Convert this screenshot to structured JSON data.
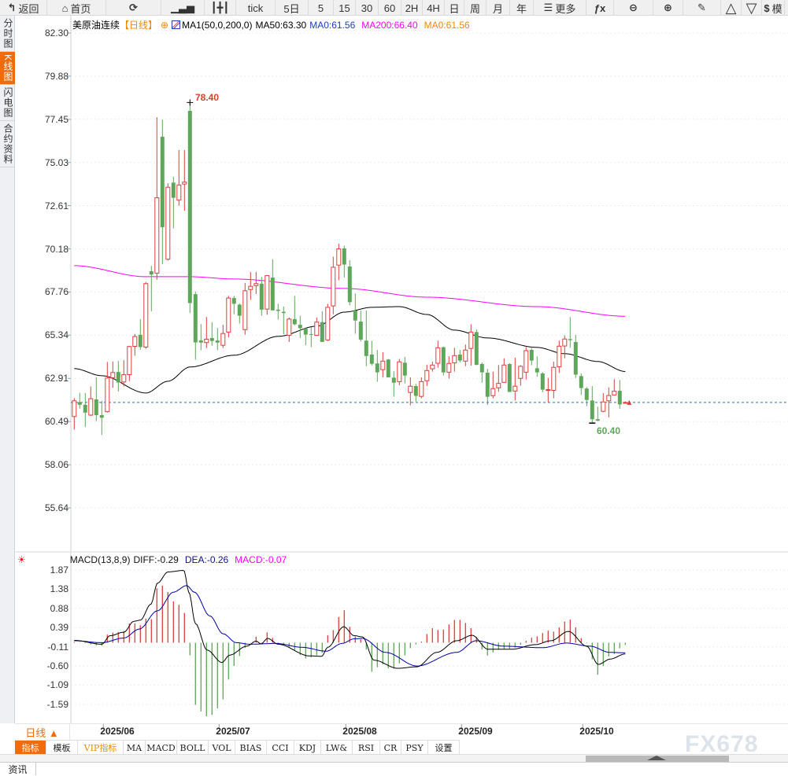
{
  "toolbar": {
    "items": [
      {
        "label": "返回",
        "icon": "back-arrow-icon"
      },
      {
        "label": "首页",
        "icon": "home-icon"
      },
      {
        "label": "",
        "icon": "refresh-icon"
      },
      {
        "label": "",
        "icon": "bar-chart-icon"
      },
      {
        "label": "",
        "icon": "candlestick-icon"
      },
      {
        "label": "tick"
      },
      {
        "label": "5日"
      },
      {
        "label": "5"
      },
      {
        "label": "15"
      },
      {
        "label": "30"
      },
      {
        "label": "60"
      },
      {
        "label": "2H"
      },
      {
        "label": "4H"
      },
      {
        "label": "日"
      },
      {
        "label": "周"
      },
      {
        "label": "月"
      },
      {
        "label": "年"
      },
      {
        "label": "更多",
        "icon": "menu-icon"
      },
      {
        "label": "fx",
        "icon": "function-icon"
      },
      {
        "label": "",
        "icon": "zoom-out-icon"
      },
      {
        "label": "",
        "icon": "zoom-in-icon"
      },
      {
        "label": "",
        "icon": "pen-icon"
      },
      {
        "label": "",
        "icon": "triangle-up-icon"
      },
      {
        "label": "",
        "icon": "triangle-down-icon"
      },
      {
        "label": "模",
        "icon": "dollar-icon"
      }
    ]
  },
  "sidebar": {
    "items": [
      {
        "label": "分时图"
      },
      {
        "label": "K线图",
        "active": true
      },
      {
        "label": "闪电图"
      },
      {
        "label": "合约资料"
      }
    ]
  },
  "legend": {
    "symbol": "美原油连续",
    "period": "【日线】",
    "indicator": "MA1(50,0,200,0)",
    "ma50": "MA50:63.30",
    "ma0a": "MA0:61.56",
    "ma200": "MA200:66.40",
    "ma0b": "MA0:61.56"
  },
  "macd_legend": {
    "name": "MACD(13,8,9)",
    "diff": "DIFF:-0.29",
    "dea": "DEA:-0.26",
    "macd": "MACD:-0.07"
  },
  "colors": {
    "up": "#e03c3c",
    "down": "#5ea65a",
    "ma50": "#000000",
    "ma200": "#ff00ff",
    "current_line": "#1e6fd9",
    "diff": "#000000",
    "dea": "#0000aa",
    "accent": "#f26b0a"
  },
  "chart_data": [
    {
      "type": "candlestick",
      "ylim": [
        55.64,
        82.3
      ],
      "y_ticks": [
        "82.30",
        "79.88",
        "77.45",
        "75.03",
        "72.61",
        "70.18",
        "67.76",
        "65.34",
        "62.91",
        "60.49",
        "58.06",
        "55.64"
      ],
      "x_ticks": [
        {
          "label": "2025/06",
          "bar": 7
        },
        {
          "label": "2025/07",
          "bar": 28
        },
        {
          "label": "2025/08",
          "bar": 51
        },
        {
          "label": "2025/09",
          "bar": 72
        },
        {
          "label": "2025/10",
          "bar": 94
        }
      ],
      "high_label": "78.40",
      "low_label": "60.40",
      "current_price": 61.56,
      "ohlc": [
        [
          60.77,
          61.8,
          60.04,
          61.65
        ],
        [
          61.58,
          62.1,
          61.21,
          61.43
        ],
        [
          61.43,
          62.1,
          60.18,
          60.99
        ],
        [
          60.85,
          62.46,
          60.8,
          61.77
        ],
        [
          61.73,
          62.98,
          60.51,
          60.85
        ],
        [
          60.85,
          61.65,
          59.74,
          60.7
        ],
        [
          61.04,
          63.83,
          60.99,
          62.93
        ],
        [
          62.95,
          63.86,
          62.39,
          63.24
        ],
        [
          63.27,
          63.89,
          62.17,
          62.68
        ],
        [
          62.71,
          63.93,
          62.46,
          63.12
        ],
        [
          63.12,
          64.74,
          62.76,
          64.7
        ],
        [
          64.71,
          65.4,
          64.18,
          65.26
        ],
        [
          65.36,
          66.24,
          64.52,
          64.67
        ],
        [
          64.67,
          68.32,
          64.57,
          68.23
        ],
        [
          68.93,
          69.23,
          66.68,
          68.74
        ],
        [
          68.82,
          77.57,
          68.45,
          73.05
        ],
        [
          76.48,
          77.43,
          69.33,
          71.4
        ],
        [
          69.6,
          73.86,
          69.52,
          73.64
        ],
        [
          73.9,
          74.23,
          71.33,
          73.05
        ],
        [
          72.93,
          75.73,
          72.61,
          73.77
        ],
        [
          73.82,
          75.73,
          72.32,
          73.93
        ],
        [
          77.93,
          78.4,
          66.58,
          67.14
        ],
        [
          67.64,
          67.79,
          63.96,
          64.93
        ],
        [
          65.04,
          65.96,
          64.49,
          64.92
        ],
        [
          64.92,
          66.36,
          64.62,
          65.11
        ],
        [
          65.18,
          66.07,
          64.74,
          65.01
        ],
        [
          65.04,
          65.74,
          64.49,
          64.92
        ],
        [
          64.77,
          65.92,
          64.62,
          65.43
        ],
        [
          65.51,
          67.54,
          65.21,
          67.42
        ],
        [
          67.42,
          67.54,
          66.51,
          67.1
        ],
        [
          67.05,
          67.12,
          65.99,
          66.43
        ],
        [
          65.65,
          68.27,
          65.37,
          67.83
        ],
        [
          67.9,
          68.89,
          67.32,
          68.08
        ],
        [
          68.12,
          68.89,
          67.65,
          68.23
        ],
        [
          68.23,
          68.61,
          66.43,
          66.77
        ],
        [
          66.8,
          68.71,
          66.48,
          68.68
        ],
        [
          68.57,
          69.6,
          66.73,
          66.73
        ],
        [
          66.77,
          67.1,
          66.21,
          66.7
        ],
        [
          66.65,
          66.95,
          65.4,
          66.58
        ],
        [
          65.33,
          66.33,
          64.96,
          66.24
        ],
        [
          66.24,
          67.54,
          65.89,
          65.95
        ],
        [
          65.92,
          66.43,
          65.18,
          65.73
        ],
        [
          65.7,
          65.77,
          64.77,
          65.37
        ],
        [
          65.4,
          65.77,
          64.67,
          65.36
        ],
        [
          65.33,
          66.33,
          65.3,
          66.07
        ],
        [
          66.07,
          66.68,
          64.96,
          64.96
        ],
        [
          65.07,
          67.1,
          65.01,
          66.9
        ],
        [
          66.98,
          69.74,
          66.51,
          69.15
        ],
        [
          69.27,
          70.48,
          68.42,
          70.18
        ],
        [
          70.21,
          70.37,
          68.57,
          69.3
        ],
        [
          69.19,
          69.54,
          67.01,
          67.19
        ],
        [
          66.72,
          67.68,
          65.42,
          66.16
        ],
        [
          66.1,
          66.72,
          64.98,
          65.09
        ],
        [
          65.03,
          66.72,
          63.6,
          64.17
        ],
        [
          64.25,
          65.03,
          63.63,
          63.73
        ],
        [
          63.75,
          64.51,
          62.72,
          63.25
        ],
        [
          63.4,
          64.38,
          62.97,
          63.88
        ],
        [
          63.97,
          64.0,
          62.97,
          62.97
        ],
        [
          62.95,
          63.31,
          61.88,
          62.67
        ],
        [
          62.73,
          64.0,
          62.53,
          63.84
        ],
        [
          63.79,
          64.12,
          62.63,
          63.07
        ],
        [
          62.12,
          62.97,
          61.4,
          62.47
        ],
        [
          62.48,
          62.6,
          61.6,
          61.93
        ],
        [
          61.9,
          62.97,
          61.79,
          62.73
        ],
        [
          62.78,
          63.68,
          62.48,
          63.35
        ],
        [
          63.45,
          63.85,
          63.29,
          63.66
        ],
        [
          63.76,
          65.03,
          63.51,
          64.63
        ],
        [
          64.66,
          64.7,
          63.07,
          63.25
        ],
        [
          63.26,
          64.15,
          62.9,
          63.75
        ],
        [
          63.78,
          64.63,
          63.29,
          64.19
        ],
        [
          64.25,
          64.51,
          63.81,
          63.91
        ],
        [
          63.88,
          64.81,
          63.6,
          64.5
        ],
        [
          64.59,
          65.95,
          63.63,
          65.51
        ],
        [
          65.51,
          65.66,
          63.65,
          63.67
        ],
        [
          63.72,
          63.81,
          62.67,
          63.25
        ],
        [
          63.23,
          63.45,
          61.42,
          61.88
        ],
        [
          61.94,
          63.29,
          61.79,
          62.34
        ],
        [
          62.38,
          63.66,
          62.16,
          62.63
        ],
        [
          62.69,
          64.04,
          62.67,
          63.66
        ],
        [
          63.72,
          63.76,
          62.15,
          62.15
        ],
        [
          62.2,
          64.07,
          61.67,
          62.47
        ],
        [
          62.91,
          63.65,
          62.5,
          63.59
        ],
        [
          63.26,
          64.67,
          62.85,
          64.47
        ],
        [
          64.51,
          64.62,
          63.65,
          63.91
        ],
        [
          63.48,
          64.15,
          63.0,
          63.25
        ],
        [
          63.19,
          63.26,
          62.13,
          62.28
        ],
        [
          62.24,
          62.93,
          61.57,
          62.28
        ],
        [
          62.24,
          63.85,
          61.79,
          63.53
        ],
        [
          63.56,
          65.03,
          63.22,
          64.72
        ],
        [
          64.73,
          65.32,
          64.04,
          65.12
        ],
        [
          65.12,
          66.35,
          64.63,
          65.06
        ],
        [
          64.95,
          65.35,
          62.94,
          63.12
        ],
        [
          63.04,
          63.19,
          61.98,
          62.37
        ],
        [
          62.34,
          62.42,
          61.35,
          61.7
        ],
        [
          61.67,
          62.48,
          60.4,
          60.62
        ],
        [
          60.62,
          61.32,
          60.5,
          60.54
        ],
        [
          61.06,
          62.09,
          61.01,
          61.59
        ],
        [
          61.65,
          62.41,
          60.72,
          61.95
        ],
        [
          61.98,
          62.87,
          61.98,
          62.19
        ],
        [
          62.21,
          62.82,
          61.2,
          61.45
        ],
        [
          61.53,
          61.62,
          61.5,
          61.56
        ]
      ],
      "ma50": [
        [
          0,
          63.46
        ],
        [
          5,
          63.06
        ],
        [
          13,
          62.09
        ],
        [
          17,
          62.75
        ],
        [
          21,
          63.55
        ],
        [
          29,
          64.21
        ],
        [
          37,
          65.27
        ],
        [
          44,
          65.84
        ],
        [
          49,
          66.63
        ],
        [
          54,
          66.9
        ],
        [
          59,
          66.94
        ],
        [
          64,
          66.5
        ],
        [
          69,
          65.62
        ],
        [
          75,
          65.18
        ],
        [
          84,
          64.65
        ],
        [
          89,
          64.3
        ],
        [
          95,
          63.86
        ],
        [
          100,
          63.3
        ]
      ],
      "ma200": [
        [
          0,
          69.24
        ],
        [
          13,
          68.62
        ],
        [
          21,
          68.62
        ],
        [
          29,
          68.49
        ],
        [
          49,
          67.96
        ],
        [
          64,
          67.47
        ],
        [
          84,
          66.94
        ],
        [
          100,
          66.4
        ]
      ]
    },
    {
      "type": "macd",
      "ylim": [
        -1.87,
        2.0
      ],
      "y_ticks": [
        "1.87",
        "1.38",
        "0.88",
        "0.39",
        "-0.11",
        "-0.60",
        "-1.09",
        "-1.59"
      ],
      "diff": [
        [
          0,
          0.06
        ],
        [
          5,
          -0.04
        ],
        [
          6.5,
          0.18
        ],
        [
          9,
          0.27
        ],
        [
          10.8,
          0.55
        ],
        [
          12,
          0.58
        ],
        [
          13.9,
          0.99
        ],
        [
          15.1,
          1.53
        ],
        [
          17,
          1.82
        ],
        [
          19.9,
          1.86
        ],
        [
          20.8,
          1.3
        ],
        [
          22,
          0.49
        ],
        [
          24.1,
          -0.19
        ],
        [
          26.8,
          -0.51
        ],
        [
          28.2,
          -0.32
        ],
        [
          31.3,
          -0.09
        ],
        [
          33,
          0.04
        ],
        [
          33.9,
          -0.03
        ],
        [
          35.1,
          0.11
        ],
        [
          37,
          -0.04
        ],
        [
          42.7,
          -0.34
        ],
        [
          44.9,
          -0.35
        ],
        [
          46,
          -0.12
        ],
        [
          48.9,
          0.41
        ],
        [
          50.8,
          0.18
        ],
        [
          52.3,
          0.15
        ],
        [
          54.4,
          -0.45
        ],
        [
          58.7,
          -0.66
        ],
        [
          62.2,
          -0.62
        ],
        [
          65.8,
          -0.25
        ],
        [
          69.4,
          0.05
        ],
        [
          72.2,
          0.19
        ],
        [
          75.1,
          -0.17
        ],
        [
          79.4,
          -0.17
        ],
        [
          83.7,
          -0.05
        ],
        [
          86.5,
          0.05
        ],
        [
          89.7,
          0.29
        ],
        [
          93,
          -0.09
        ],
        [
          95.1,
          -0.56
        ],
        [
          97.3,
          -0.42
        ],
        [
          100,
          -0.29
        ]
      ],
      "dea": [
        [
          0,
          0.05
        ],
        [
          5,
          0.0
        ],
        [
          9,
          0.12
        ],
        [
          11.8,
          0.35
        ],
        [
          15.1,
          0.82
        ],
        [
          18,
          1.3
        ],
        [
          20.4,
          1.47
        ],
        [
          21.8,
          1.3
        ],
        [
          24.6,
          0.69
        ],
        [
          27,
          0.23
        ],
        [
          29.4,
          0.0
        ],
        [
          31.8,
          -0.04
        ],
        [
          36.6,
          -0.02
        ],
        [
          41.4,
          -0.12
        ],
        [
          45.7,
          -0.22
        ],
        [
          48.6,
          -0.02
        ],
        [
          50.8,
          0.1
        ],
        [
          52.3,
          0.11
        ],
        [
          56.5,
          -0.25
        ],
        [
          62.2,
          -0.6
        ],
        [
          69.4,
          -0.25
        ],
        [
          72.9,
          0.05
        ],
        [
          77.9,
          -0.09
        ],
        [
          85,
          -0.13
        ],
        [
          89.3,
          -0.01
        ],
        [
          93.6,
          -0.09
        ],
        [
          97.2,
          -0.25
        ],
        [
          100,
          -0.26
        ]
      ]
    }
  ],
  "bottom": {
    "period_label": "日线 ▲",
    "tabs": [
      {
        "label": "指标",
        "active": true
      },
      {
        "label": "模板"
      },
      {
        "label": "VIP指标",
        "vip": true
      },
      {
        "label": "MA"
      },
      {
        "label": "MACD"
      },
      {
        "label": "BOLL"
      },
      {
        "label": "VOL"
      },
      {
        "label": "BIAS"
      },
      {
        "label": "CCI"
      },
      {
        "label": "KDJ"
      },
      {
        "label": "LW&"
      },
      {
        "label": "RSI"
      },
      {
        "label": "CR"
      },
      {
        "label": "PSY"
      },
      {
        "label": "设置"
      }
    ],
    "news_tab": "资讯",
    "watermark": "FX678"
  }
}
